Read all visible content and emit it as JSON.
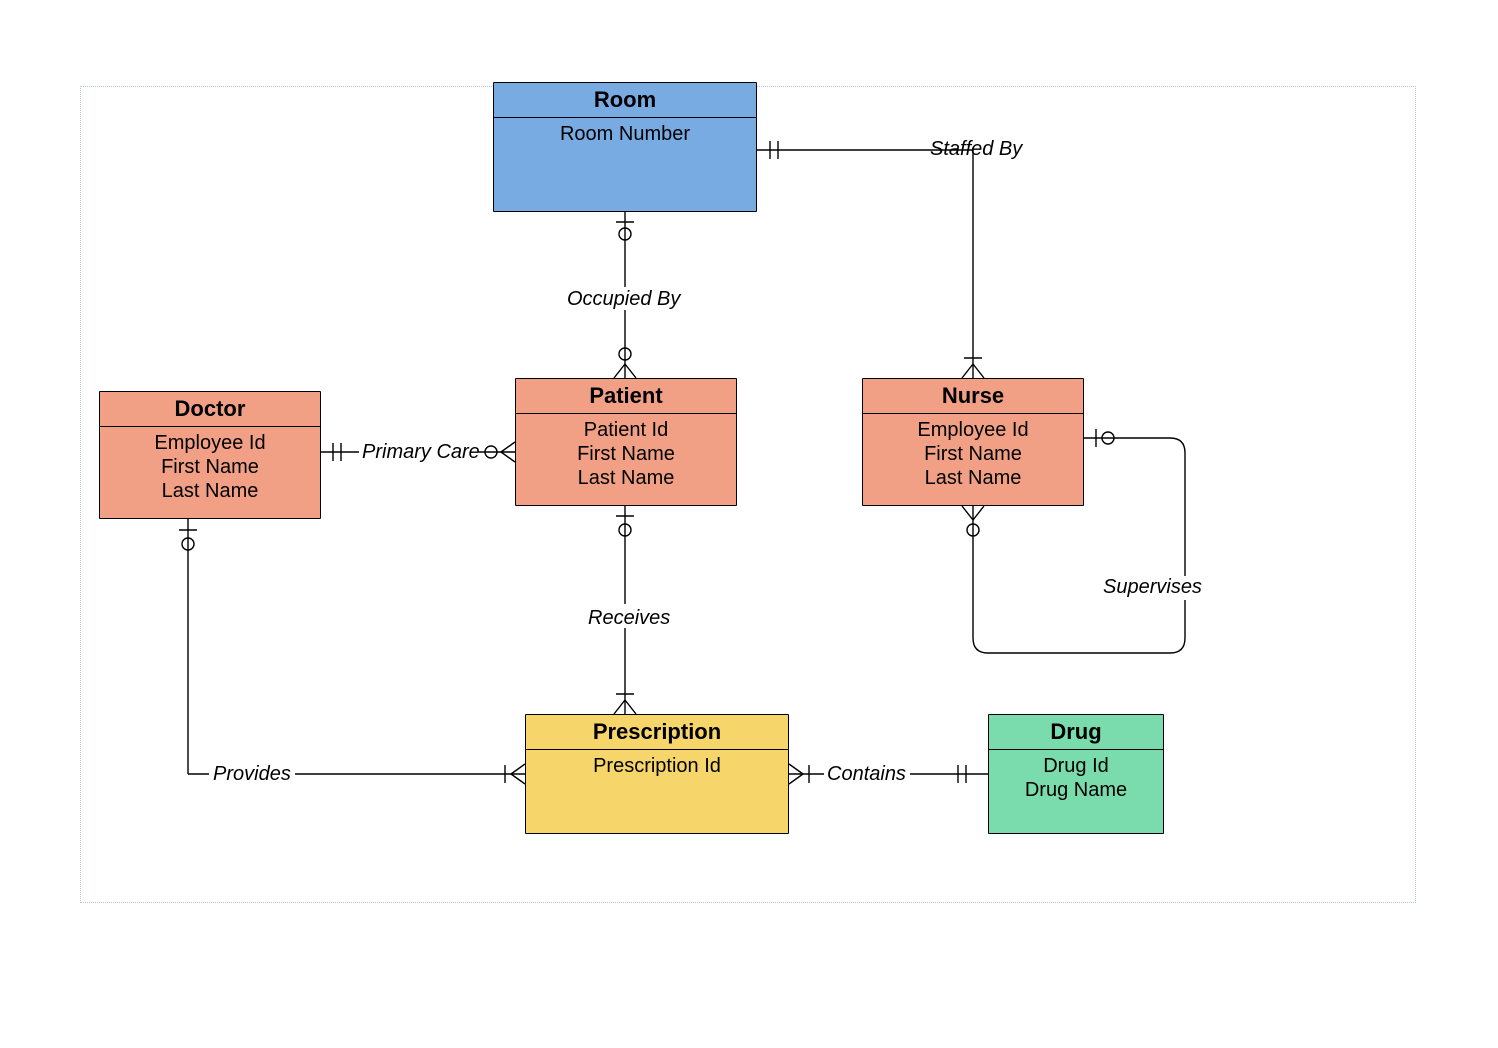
{
  "entities": {
    "room": {
      "title": "Room",
      "attrs": [
        "Room Number"
      ],
      "color": "#79abe3"
    },
    "doctor": {
      "title": "Doctor",
      "attrs": [
        "Employee Id",
        "First Name",
        "Last Name"
      ],
      "color": "#f1a085"
    },
    "patient": {
      "title": "Patient",
      "attrs": [
        "Patient Id",
        "First Name",
        "Last Name"
      ],
      "color": "#f1a085"
    },
    "nurse": {
      "title": "Nurse",
      "attrs": [
        "Employee Id",
        "First Name",
        "Last Name"
      ],
      "color": "#f1a085"
    },
    "prescription": {
      "title": "Prescription",
      "attrs": [
        "Prescription Id"
      ],
      "color": "#f6d56a"
    },
    "drug": {
      "title": "Drug",
      "attrs": [
        "Drug Id",
        "Drug Name"
      ],
      "color": "#7adcac"
    }
  },
  "relationships": {
    "staffed_by": "Staffed By",
    "occupied_by": "Occupied By",
    "primary_care": "Primary Care",
    "receives": "Receives",
    "provides": "Provides",
    "contains": "Contains",
    "supervises": "Supervises"
  }
}
